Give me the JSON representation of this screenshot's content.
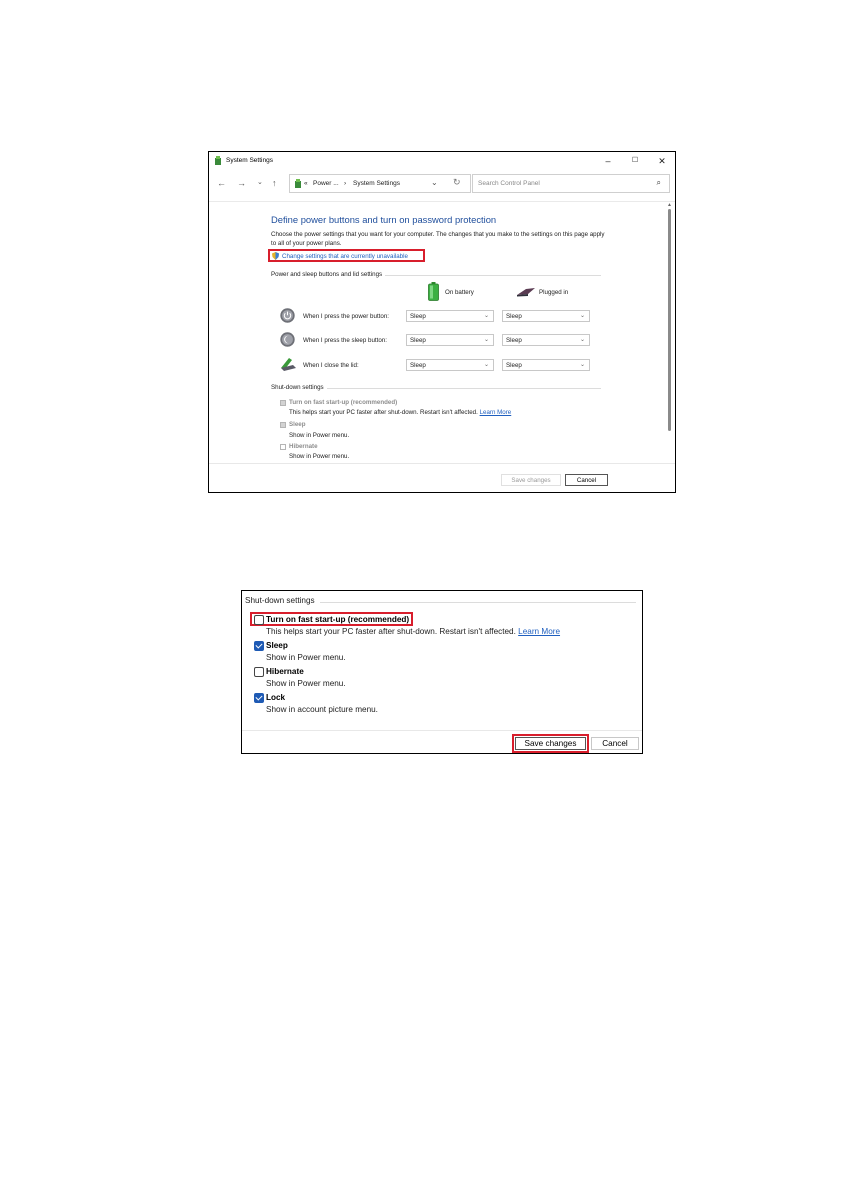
{
  "window": {
    "title": "System Settings",
    "controls": {
      "minimize": "–",
      "maximize": "☐",
      "close": "✕"
    }
  },
  "nav": {
    "back": "←",
    "forward": "→",
    "recent": "⌄",
    "up": "↑",
    "address_sep": "«",
    "crumb1": "Power ...",
    "crumb_arrow": "›",
    "crumb2": "System Settings",
    "address_chevron": "⌄",
    "refresh": "↻",
    "search_placeholder": "Search Control Panel",
    "search_icon": "⌕"
  },
  "main": {
    "heading": "Define power buttons and turn on password protection",
    "description": "Choose the power settings that you want for your computer. The changes that you make to the settings on this page apply to all of your power plans.",
    "change_link": "Change settings that are currently unavailable",
    "power_group_label": "Power and sleep buttons and lid settings",
    "col_battery": "On battery",
    "col_plugged": "Plugged in",
    "rows": [
      {
        "label": "When I press the power button:",
        "battery": "Sleep",
        "plugged": "Sleep",
        "icon": "power-button-icon"
      },
      {
        "label": "When I press the sleep button:",
        "battery": "Sleep",
        "plugged": "Sleep",
        "icon": "sleep-button-icon"
      },
      {
        "label": "When I close the lid:",
        "battery": "Sleep",
        "plugged": "Sleep",
        "icon": "laptop-lid-icon"
      }
    ],
    "shutdown_label": "Shut-down settings",
    "fast_startup": "Turn on fast start-up (recommended)",
    "fast_startup_desc": "This helps start your PC faster after shut-down. Restart isn't affected.",
    "learn_more": "Learn More",
    "sleep": "Sleep",
    "sleep_desc": "Show in Power menu.",
    "hibernate": "Hibernate",
    "hibernate_desc": "Show in Power menu.",
    "save": "Save changes",
    "cancel": "Cancel"
  },
  "panel": {
    "shutdown_label": "Shut-down settings",
    "options": [
      {
        "label": "Turn on fast start-up (recommended)",
        "desc": "This helps start your PC faster after shut-down. Restart isn't affected.",
        "link": "Learn More",
        "checked": false
      },
      {
        "label": "Sleep",
        "desc": "Show in Power menu.",
        "checked": true
      },
      {
        "label": "Hibernate",
        "desc": "Show in Power menu.",
        "checked": false
      },
      {
        "label": "Lock",
        "desc": "Show in account picture menu.",
        "checked": true
      }
    ],
    "save": "Save changes",
    "cancel": "Cancel"
  },
  "colors": {
    "accent": "#1e5ab4",
    "heading": "#1f4e9c",
    "link": "#1f5fbf",
    "highlight": "#d81e2c"
  }
}
